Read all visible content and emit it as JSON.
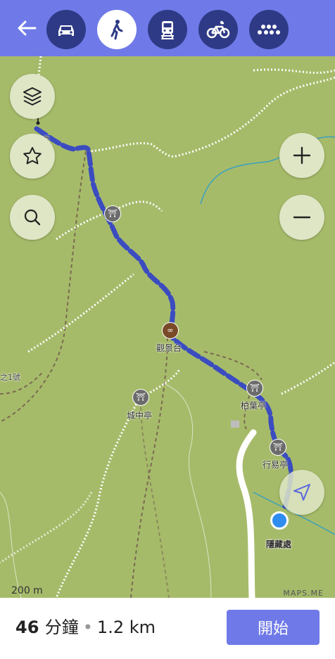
{
  "topbar": {
    "modes": [
      {
        "icon": "car-icon"
      },
      {
        "icon": "walk-icon"
      },
      {
        "icon": "train-icon"
      },
      {
        "icon": "bicycle-icon"
      },
      {
        "icon": "more-icon"
      }
    ],
    "active_mode": "walk-icon"
  },
  "map": {
    "labels": {
      "start": "隱藏處",
      "viewpoint": "觀景台",
      "pavilion_city": "城中亭",
      "pavilion_leaf": "柏葉亭",
      "pavilion_walk": "行易亭",
      "destination": "隱藏處",
      "trail_left": "之1號"
    },
    "scale": "200 m",
    "attribution": "MAPS.ME"
  },
  "summary": {
    "time": "46",
    "time_unit": "分鐘",
    "separator": "•",
    "distance": "1.2 km"
  },
  "start_button": "開始",
  "colors": {
    "accent": "#6f7ae8",
    "route": "#3b4cc0",
    "map": "#a6bb6a",
    "dark_button": "#2f3a86"
  }
}
